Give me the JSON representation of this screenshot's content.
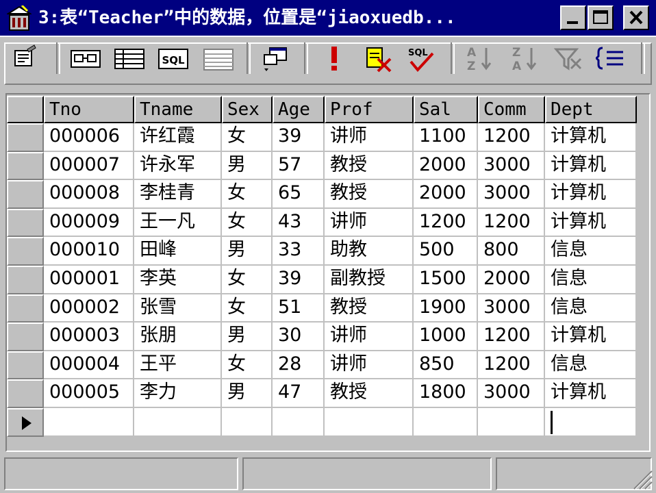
{
  "window": {
    "title": "3:表“Teacher”中的数据，位置是“jiaoxuedb..."
  },
  "title_icon": "sql-server-app-icon",
  "caption_buttons": [
    "minimize-icon",
    "maximize-icon",
    "close-icon"
  ],
  "toolbar": {
    "icons": [
      "properties-icon",
      "show-diagram-pane-icon",
      "show-grid-pane-icon",
      "show-sql-pane-icon",
      "show-results-pane-icon",
      "change-query-type-icon",
      "run-icon",
      "clear-results-icon",
      "verify-sql-icon",
      "sort-ascending-icon",
      "sort-descending-icon",
      "remove-filter-icon",
      "group-by-icon"
    ],
    "sql_label": "SQL"
  },
  "table": {
    "columns": [
      "Tno",
      "Tname",
      "Sex",
      "Age",
      "Prof",
      "Sal",
      "Comm",
      "Dept"
    ],
    "rows": [
      [
        "000006",
        "许红霞",
        "女",
        "39",
        "讲师",
        "1100",
        "1200",
        "计算机"
      ],
      [
        "000007",
        "许永军",
        "男",
        "57",
        "教授",
        "2000",
        "3000",
        "计算机"
      ],
      [
        "000008",
        "李桂青",
        "女",
        "65",
        "教授",
        "2000",
        "3000",
        "计算机"
      ],
      [
        "000009",
        "王一凡",
        "女",
        "43",
        "讲师",
        "1200",
        "1200",
        "计算机"
      ],
      [
        "000010",
        "田峰",
        "男",
        "33",
        "助教",
        "500",
        "800",
        "信息"
      ],
      [
        "000001",
        "李英",
        "女",
        "39",
        "副教授",
        "1500",
        "2000",
        "信息"
      ],
      [
        "000002",
        "张雪",
        "女",
        "51",
        "教授",
        "1900",
        "3000",
        "信息"
      ],
      [
        "000003",
        "张朋",
        "男",
        "30",
        "讲师",
        "1000",
        "1200",
        "计算机"
      ],
      [
        "000004",
        "王平",
        "女",
        "28",
        "讲师",
        "850",
        "1200",
        "信息"
      ],
      [
        "000005",
        "李力",
        "男",
        "47",
        "教授",
        "1800",
        "3000",
        "计算机"
      ]
    ],
    "new_row_indicator": "current-row-arrow-icon"
  },
  "statusbar": {
    "panes": [
      "",
      "",
      ""
    ],
    "grip_icon": "resize-grip-icon"
  }
}
